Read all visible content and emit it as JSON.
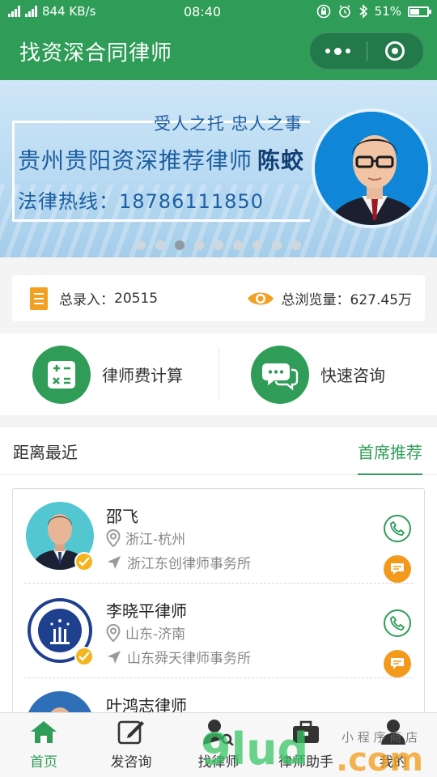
{
  "status_bar": {
    "network": "844 KB/s",
    "time": "08:40",
    "battery": "51%",
    "battery_level": 0.51,
    "signal_labels": [
      "4G",
      "3G"
    ]
  },
  "header": {
    "title": "找资深合同律师"
  },
  "banner": {
    "slogan": "受人之托  忠人之事",
    "headline_prefix": "贵州贵阳资深推荐律师",
    "headline_name": "陈蛟",
    "hotline": "法律热线：18786111850",
    "active_slide": 3,
    "slide_count": 9
  },
  "stats": {
    "entries_label": "总录入：",
    "entries_value": "20515",
    "views_label": "总浏览量：",
    "views_value": "627.45万"
  },
  "actions": [
    {
      "label": "律师费计算",
      "icon": "calculator-icon"
    },
    {
      "label": "快速咨询",
      "icon": "chat-bubble-icon"
    }
  ],
  "tabs": {
    "nearest": "距离最近",
    "recommended": "首席推荐",
    "active": "recommended"
  },
  "lawyers": [
    {
      "name": "邵飞",
      "region": "浙江-杭州",
      "firm": "浙江东创律师事务所"
    },
    {
      "name": "李晓平律师",
      "region": "山东-济南",
      "firm": "山东舜天律师事务所"
    },
    {
      "name": "叶鸿志律师",
      "region": "",
      "firm": ""
    }
  ],
  "tabbar": {
    "items": [
      {
        "label": "首页",
        "icon": "home-icon",
        "active": true
      },
      {
        "label": "发咨询",
        "icon": "edit-icon",
        "active": false
      },
      {
        "label": "找律师",
        "icon": "search-user-icon",
        "active": false
      },
      {
        "label": "律师助手",
        "icon": "briefcase-icon",
        "active": false
      },
      {
        "label": "我的",
        "icon": "user-icon",
        "active": false
      }
    ]
  },
  "watermark": {
    "text": "9lud.com",
    "subtext": "小程序商店"
  },
  "colors": {
    "primary": "#2f9d57",
    "accent": "#f39a1c",
    "banner_text": "#1c5ea0"
  }
}
